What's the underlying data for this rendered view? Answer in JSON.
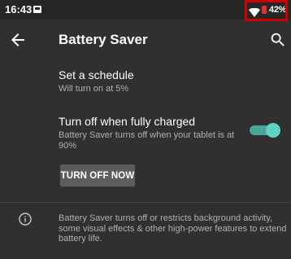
{
  "status_bar": {
    "time": "16:43",
    "battery_percent": "42%",
    "battery_color": "#e03030",
    "highlight_color": "#d10000",
    "icons": [
      "notification-icon",
      "wifi-icon",
      "battery-icon"
    ]
  },
  "app_bar": {
    "title": "Battery Saver",
    "back_icon": "arrow-left-icon",
    "search_icon": "search-icon"
  },
  "settings": {
    "schedule": {
      "title": "Set a schedule",
      "subtitle": "Will turn on at 5%"
    },
    "turn_off_when_charged": {
      "title": "Turn off when fully charged",
      "subtitle": "Battery Saver turns off when your tablet is at 90%",
      "enabled": true,
      "accent_color": "#5fd3bf"
    }
  },
  "turn_off_button": {
    "label": "TURN OFF NOW"
  },
  "info": {
    "icon": "info-icon",
    "text": "Battery Saver turns off or restricts background activity, some visual effects & other high-power features to extend battery life."
  }
}
